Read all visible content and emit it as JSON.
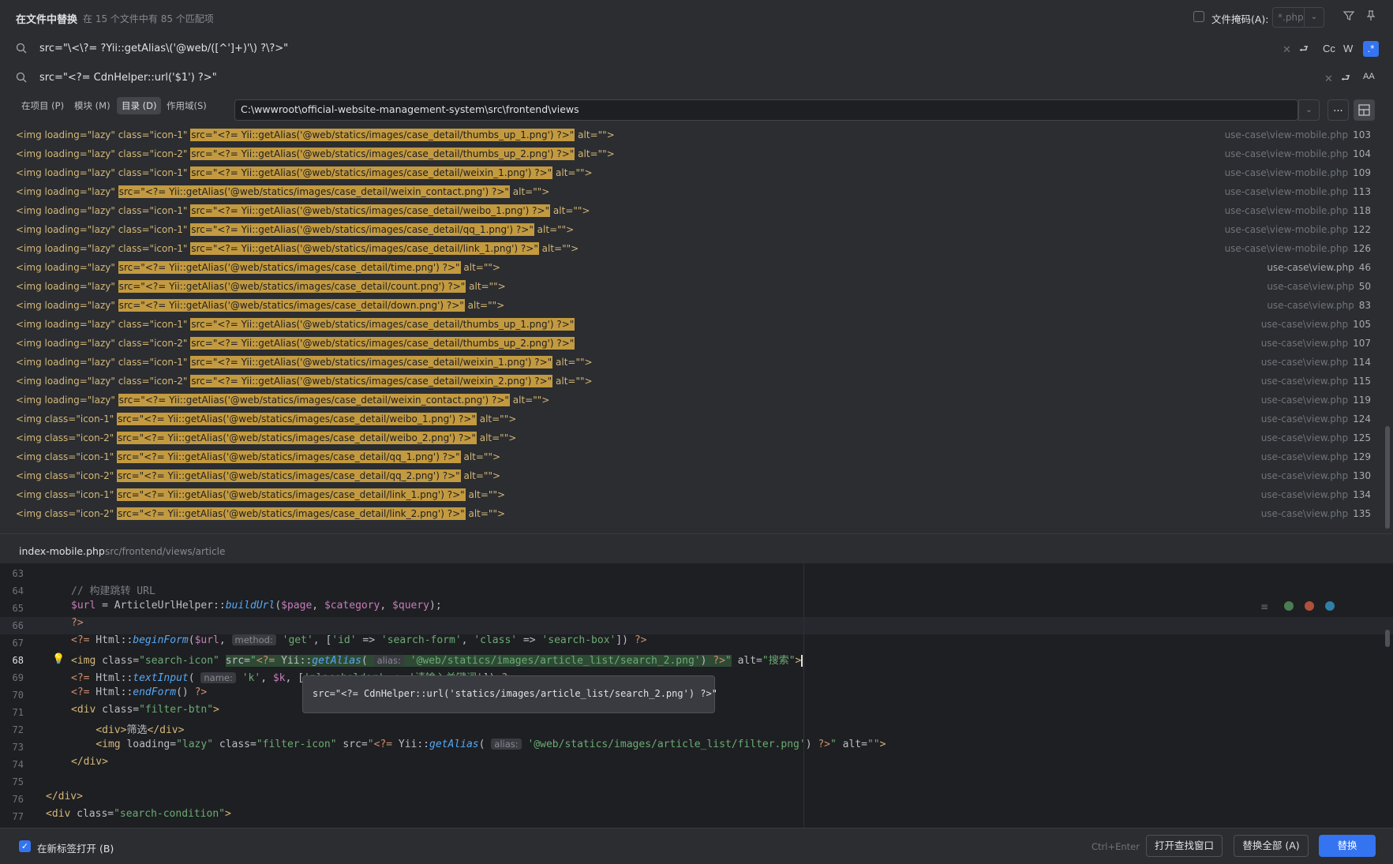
{
  "header": {
    "title": "在文件中替换",
    "summary": "在 15 个文件中有 85 个匹配项",
    "file_mask_label": "文件掩码(A):",
    "file_mask_value": "*.php"
  },
  "search": {
    "find": "src=\"\\<\\?= ?Yii::getAlias\\('@web/([^']+)'\\) ?\\?>\"",
    "replace": "src=\"<?= CdnHelper::url('$1') ?>\"",
    "opt_case": "Cc",
    "opt_word": "W",
    "opt_regex": ".*",
    "opt_preserve": "AA"
  },
  "scope": {
    "tabs": [
      "在项目 (P)",
      "模块 (M)",
      "目录 (D)",
      "作用域(S)"
    ],
    "selected": "目录 (D)",
    "directory": "C:\\wwwroot\\official-website-management-system\\src\\frontend\\views",
    "browse": "..."
  },
  "results": [
    {
      "pre": "<img loading=\"lazy\" class=\"icon-1\" ",
      "match": "src=\"<?= Yii::getAlias('@web/statics/images/case_detail/thumbs_up_1.png') ?>\"",
      "post": " alt=\"\">",
      "file": "use-case\\view-mobile.php",
      "line": "103"
    },
    {
      "pre": "<img loading=\"lazy\" class=\"icon-2\" ",
      "match": "src=\"<?= Yii::getAlias('@web/statics/images/case_detail/thumbs_up_2.png') ?>\"",
      "post": " alt=\"\">",
      "file": "use-case\\view-mobile.php",
      "line": "104"
    },
    {
      "pre": "<img loading=\"lazy\" class=\"icon-1\" ",
      "match": "src=\"<?= Yii::getAlias('@web/statics/images/case_detail/weixin_1.png') ?>\"",
      "post": " alt=\"\">",
      "file": "use-case\\view-mobile.php",
      "line": "109"
    },
    {
      "pre": "<img loading=\"lazy\" ",
      "match": "src=\"<?= Yii::getAlias('@web/statics/images/case_detail/weixin_contact.png') ?>\"",
      "post": " alt=\"\">",
      "file": "use-case\\view-mobile.php",
      "line": "113"
    },
    {
      "pre": "<img loading=\"lazy\" class=\"icon-1\" ",
      "match": "src=\"<?= Yii::getAlias('@web/statics/images/case_detail/weibo_1.png') ?>\"",
      "post": " alt=\"\">",
      "file": "use-case\\view-mobile.php",
      "line": "118"
    },
    {
      "pre": "<img loading=\"lazy\" class=\"icon-1\" ",
      "match": "src=\"<?= Yii::getAlias('@web/statics/images/case_detail/qq_1.png') ?>\"",
      "post": " alt=\"\">",
      "file": "use-case\\view-mobile.php",
      "line": "122"
    },
    {
      "pre": "<img loading=\"lazy\" class=\"icon-1\" ",
      "match": "src=\"<?= Yii::getAlias('@web/statics/images/case_detail/link_1.png') ?>\"",
      "post": " alt=\"\">",
      "file": "use-case\\view-mobile.php",
      "line": "126"
    },
    {
      "pre": "<img loading=\"lazy\" ",
      "match": "src=\"<?= Yii::getAlias('@web/statics/images/case_detail/time.png') ?>\"",
      "post": " alt=\"\">",
      "file": "use-case\\view.php",
      "line": "46"
    },
    {
      "pre": "<img loading=\"lazy\" ",
      "match": "src=\"<?= Yii::getAlias('@web/statics/images/case_detail/count.png') ?>\"",
      "post": " alt=\"\">",
      "file": "use-case\\view.php",
      "line": "50"
    },
    {
      "pre": "<img loading=\"lazy\" ",
      "match": "src=\"<?= Yii::getAlias('@web/statics/images/case_detail/down.png') ?>\"",
      "post": " alt=\"\">",
      "file": "use-case\\view.php",
      "line": "83"
    },
    {
      "pre": "<img loading=\"lazy\" class=\"icon-1\" ",
      "match": "src=\"<?= Yii::getAlias('@web/statics/images/case_detail/thumbs_up_1.png') ?>\"",
      "post": "",
      "file": "use-case\\view.php",
      "line": "105"
    },
    {
      "pre": "<img loading=\"lazy\" class=\"icon-2\" ",
      "match": "src=\"<?= Yii::getAlias('@web/statics/images/case_detail/thumbs_up_2.png') ?>\"",
      "post": "",
      "file": "use-case\\view.php",
      "line": "107"
    },
    {
      "pre": "<img loading=\"lazy\" class=\"icon-1\" ",
      "match": "src=\"<?= Yii::getAlias('@web/statics/images/case_detail/weixin_1.png') ?>\"",
      "post": " alt=\"\">",
      "file": "use-case\\view.php",
      "line": "114"
    },
    {
      "pre": "<img loading=\"lazy\" class=\"icon-2\" ",
      "match": "src=\"<?= Yii::getAlias('@web/statics/images/case_detail/weixin_2.png') ?>\"",
      "post": " alt=\"\">",
      "file": "use-case\\view.php",
      "line": "115"
    },
    {
      "pre": "<img loading=\"lazy\" ",
      "match": "src=\"<?= Yii::getAlias('@web/statics/images/case_detail/weixin_contact.png') ?>\"",
      "post": " alt=\"\">",
      "file": "use-case\\view.php",
      "line": "119"
    },
    {
      "pre": "<img class=\"icon-1\" ",
      "match": "src=\"<?= Yii::getAlias('@web/statics/images/case_detail/weibo_1.png') ?>\"",
      "post": " alt=\"\">",
      "file": "use-case\\view.php",
      "line": "124"
    },
    {
      "pre": "<img class=\"icon-2\" ",
      "match": "src=\"<?= Yii::getAlias('@web/statics/images/case_detail/weibo_2.png') ?>\"",
      "post": " alt=\"\">",
      "file": "use-case\\view.php",
      "line": "125"
    },
    {
      "pre": "<img class=\"icon-1\" ",
      "match": "src=\"<?= Yii::getAlias('@web/statics/images/case_detail/qq_1.png') ?>\"",
      "post": " alt=\"\">",
      "file": "use-case\\view.php",
      "line": "129"
    },
    {
      "pre": "<img class=\"icon-2\" ",
      "match": "src=\"<?= Yii::getAlias('@web/statics/images/case_detail/qq_2.png') ?>\"",
      "post": " alt=\"\">",
      "file": "use-case\\view.php",
      "line": "130"
    },
    {
      "pre": "<img class=\"icon-1\" ",
      "match": "src=\"<?= Yii::getAlias('@web/statics/images/case_detail/link_1.png') ?>\"",
      "post": " alt=\"\">",
      "file": "use-case\\view.php",
      "line": "134"
    },
    {
      "pre": "<img class=\"icon-2\" ",
      "match": "src=\"<?= Yii::getAlias('@web/statics/images/case_detail/link_2.png') ?>\"",
      "post": " alt=\"\">",
      "file": "use-case\\view.php",
      "line": "135"
    }
  ],
  "preview": {
    "file_name": "index-mobile.php",
    "file_path": "src/frontend/views/article",
    "line_numbers": [
      "63",
      "64",
      "65",
      "66",
      "67",
      "68",
      "69",
      "70",
      "71",
      "72",
      "73",
      "74",
      "75",
      "76",
      "77"
    ],
    "current_line": "68",
    "tooltip": "src=\"<?= CdnHelper::url('statics/images/article_list/search_2.png') ?>\""
  },
  "footer": {
    "new_tab_label": "在新标签打开 (B)",
    "shortcut": "Ctrl+Enter",
    "open_window": "打开查找窗口",
    "replace_all": "替换全部 (A)",
    "replace": "替换"
  }
}
